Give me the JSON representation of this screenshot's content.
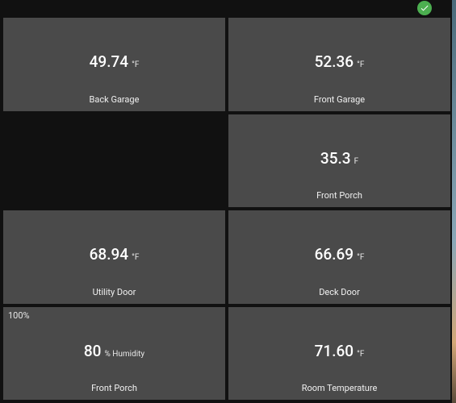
{
  "status": {
    "ok": true
  },
  "cards": [
    {
      "value": "49.74",
      "unit": "°F",
      "label": "Back Garage",
      "corner": null,
      "empty": false
    },
    {
      "value": "52.36",
      "unit": "°F",
      "label": "Front Garage",
      "corner": null,
      "empty": false
    },
    {
      "value": null,
      "unit": null,
      "label": null,
      "corner": null,
      "empty": true
    },
    {
      "value": "35.3",
      "unit": "F",
      "label": "Front Porch",
      "corner": null,
      "empty": false
    },
    {
      "value": "68.94",
      "unit": "°F",
      "label": "Utility Door",
      "corner": null,
      "empty": false
    },
    {
      "value": "66.69",
      "unit": "°F",
      "label": "Deck Door",
      "corner": null,
      "empty": false
    },
    {
      "value": "80",
      "unit": "% Humidity",
      "label": "Front Porch",
      "corner": "100%",
      "empty": false
    },
    {
      "value": "71.60",
      "unit": "°F",
      "label": "Room Temperature",
      "corner": null,
      "empty": false
    }
  ]
}
